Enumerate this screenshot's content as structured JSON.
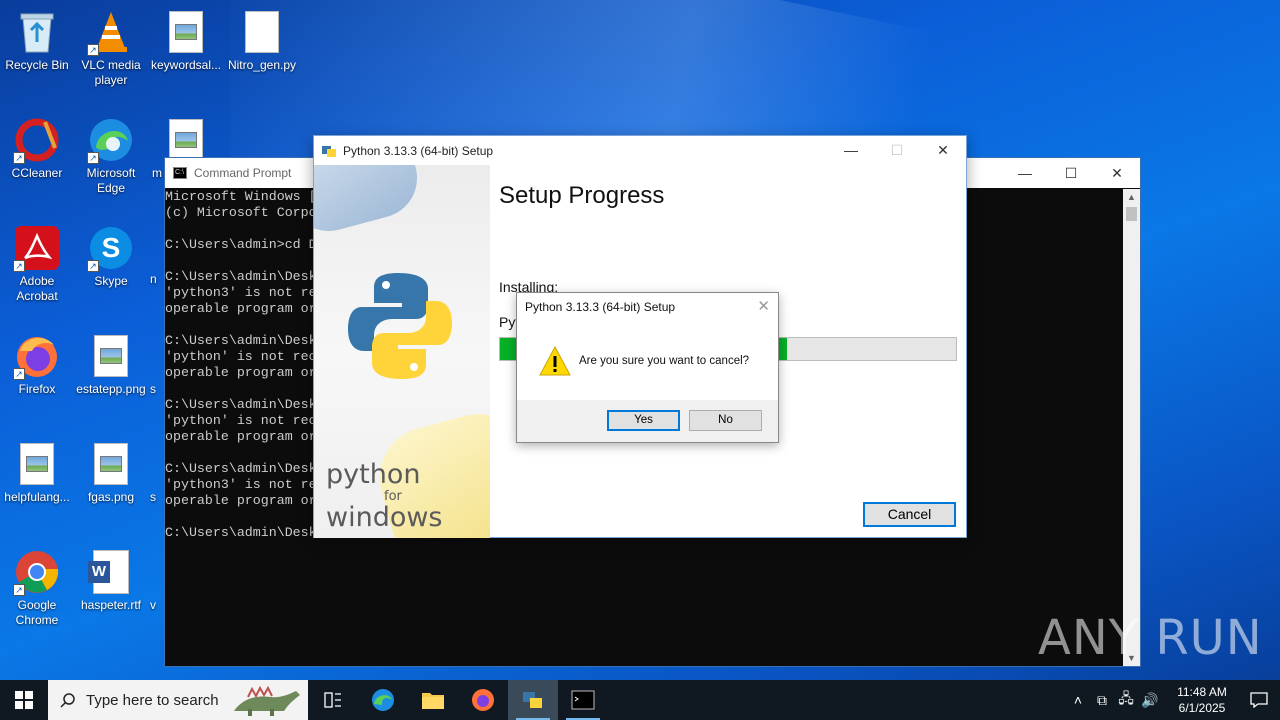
{
  "desktop": {
    "icons": [
      {
        "label": "Recycle Bin",
        "icon": "recycle-bin-icon"
      },
      {
        "label": "VLC media player",
        "icon": "vlc-icon"
      },
      {
        "label": "keywordsal...",
        "icon": "image-file-icon"
      },
      {
        "label": "Nitro_gen.py",
        "icon": "blank-file-icon"
      },
      {
        "label": "CCleaner",
        "icon": "ccleaner-icon"
      },
      {
        "label": "Microsoft Edge",
        "icon": "edge-icon"
      },
      {
        "label": "m",
        "icon": "image-file-icon"
      },
      {
        "label": "Adobe Acrobat",
        "icon": "acrobat-icon"
      },
      {
        "label": "Skype",
        "icon": "skype-icon"
      },
      {
        "label": "n",
        "icon": ""
      },
      {
        "label": "Firefox",
        "icon": "firefox-icon"
      },
      {
        "label": "estatepp.png",
        "icon": "image-file-icon"
      },
      {
        "label": "s",
        "icon": ""
      },
      {
        "label": "helpfulang...",
        "icon": "image-file-icon"
      },
      {
        "label": "fgas.png",
        "icon": "image-file-icon"
      },
      {
        "label": "s",
        "icon": ""
      },
      {
        "label": "Google Chrome",
        "icon": "chrome-icon"
      },
      {
        "label": "haspeter.rtf",
        "icon": "word-doc-icon"
      },
      {
        "label": "v",
        "icon": ""
      }
    ]
  },
  "cmd": {
    "title": "Command Prompt",
    "lines": [
      "Microsoft Windows [",
      "(c) Microsoft Corpo",
      "",
      "C:\\Users\\admin>cd D",
      "",
      "C:\\Users\\admin\\Desk",
      "'python3' is not re",
      "operable program or",
      "",
      "C:\\Users\\admin\\Desk",
      "'python' is not rec",
      "operable program or",
      "",
      "C:\\Users\\admin\\Desk",
      "'python' is not rec",
      "operable program or",
      "",
      "C:\\Users\\admin\\Desk",
      "'python3' is not re",
      "operable program or",
      "",
      "C:\\Users\\admin\\Desk"
    ]
  },
  "setup": {
    "title": "Python 3.13.3 (64-bit) Setup",
    "heading": "Setup Progress",
    "status": "Installing:",
    "package": "Pyt",
    "progress_percent": 63,
    "cancel_label": "Cancel",
    "side_line1": "python",
    "side_line2": "for",
    "side_line3": "windows"
  },
  "dialog": {
    "title": "Python 3.13.3 (64-bit) Setup",
    "message": "Are you sure you want to cancel?",
    "yes_label": "Yes",
    "no_label": "No"
  },
  "watermark": "ANY RUN",
  "taskbar": {
    "search_placeholder": "Type here to search",
    "time": "11:48 AM",
    "date": "6/1/2025"
  }
}
